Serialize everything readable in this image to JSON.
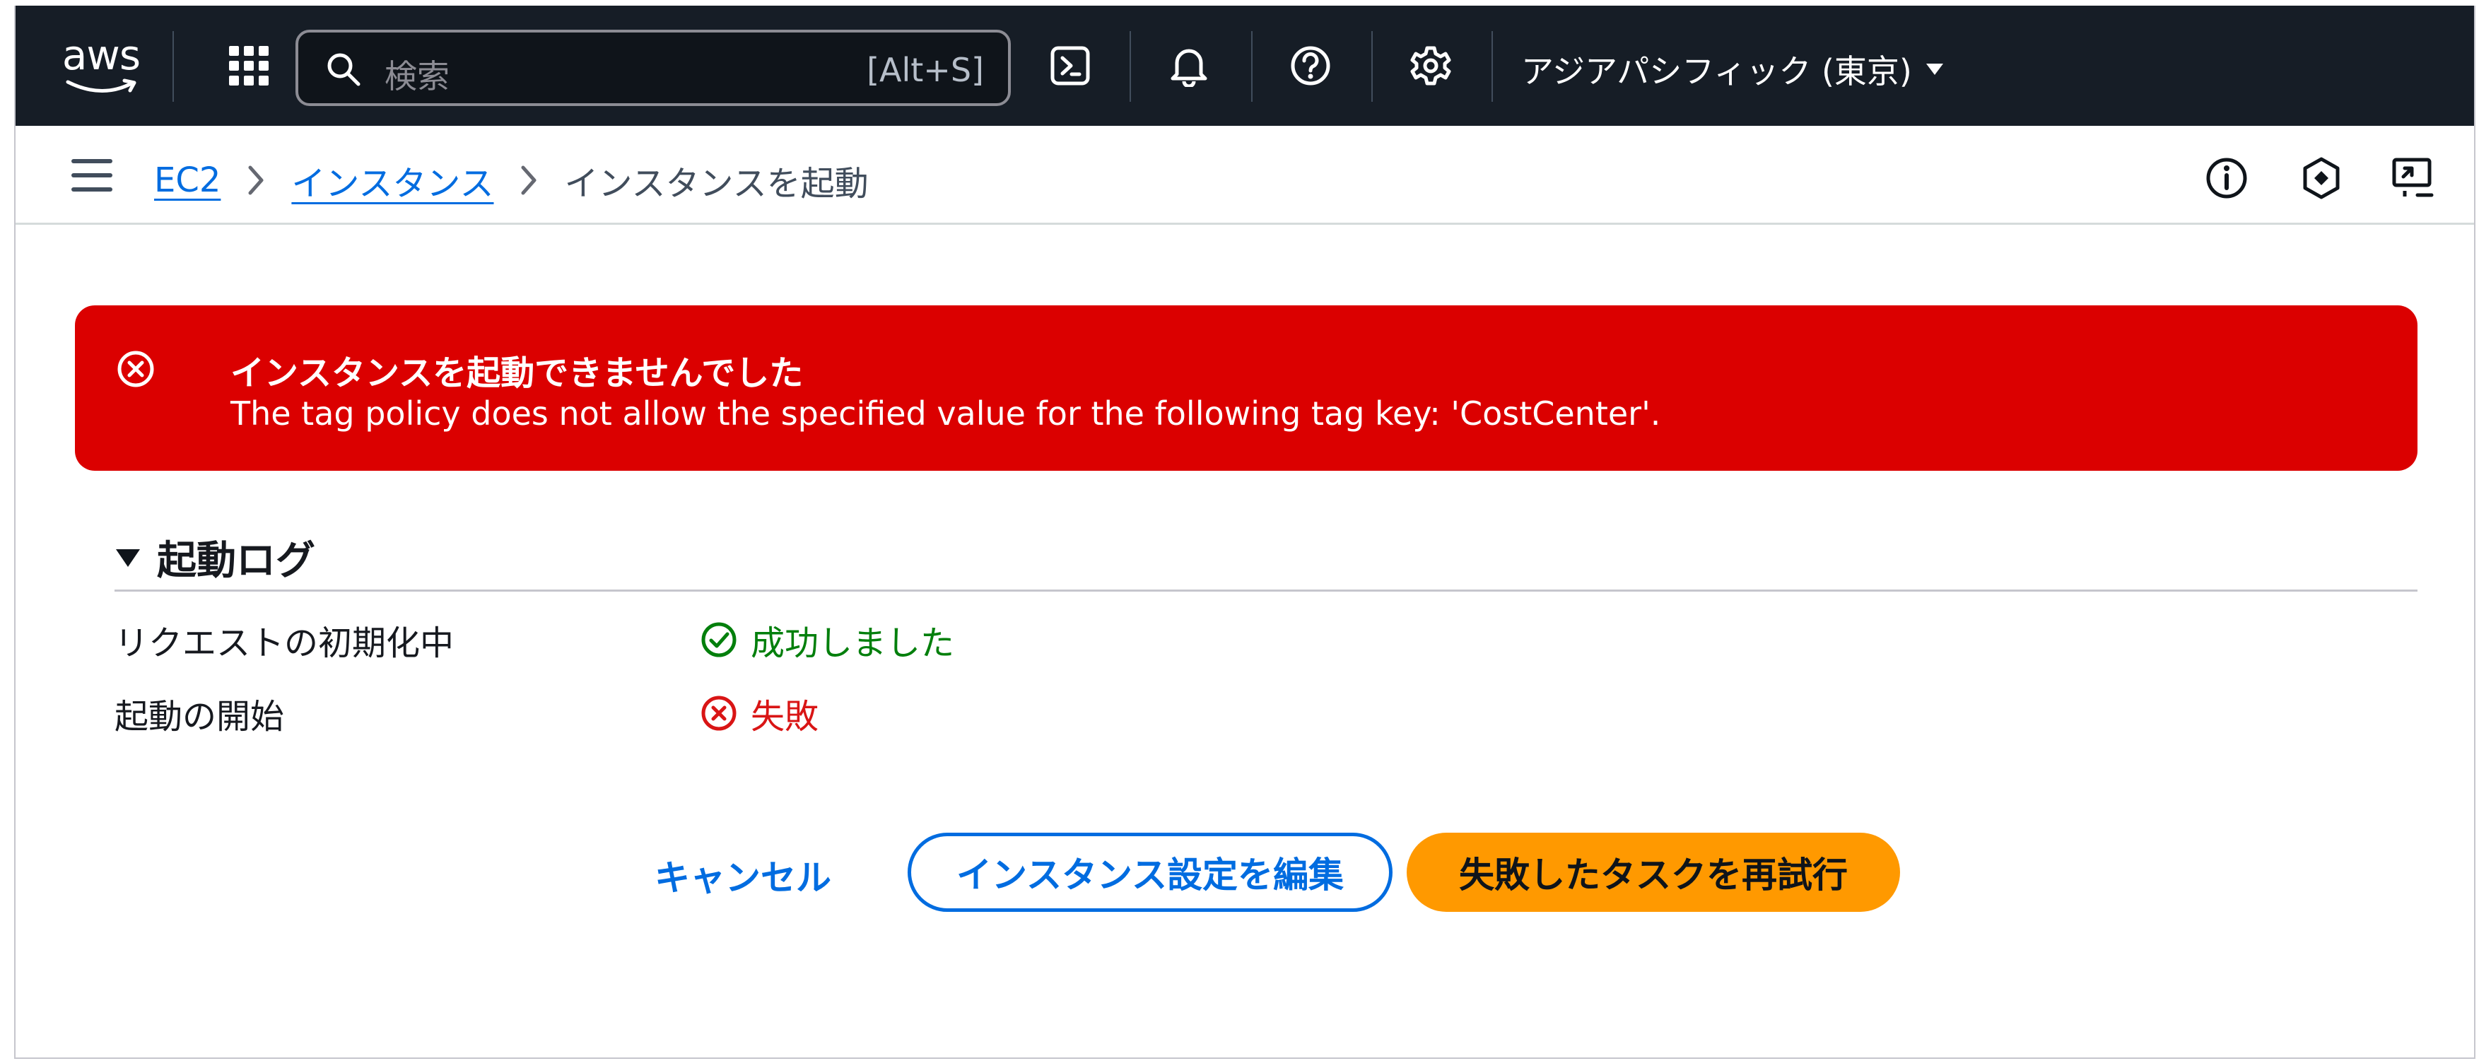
{
  "nav": {
    "logo_text": "aws",
    "search_placeholder": "検索",
    "search_shortcut": "[Alt+S]",
    "region_label": "アジアパシフィック (東京)",
    "icons": [
      "apps-grid-icon",
      "search-icon",
      "cloudshell-icon",
      "bell-icon",
      "help-icon",
      "gear-icon",
      "caret-down-icon"
    ]
  },
  "breadcrumb": {
    "items": [
      "EC2",
      "インスタンス"
    ],
    "current": "インスタンスを起動"
  },
  "alert": {
    "title": "インスタンスを起動できませんでした",
    "message": "The tag policy does not allow the specified value for the following tag key: 'CostCenter'.",
    "color": "#db0000"
  },
  "launch_log": {
    "heading": "起動ログ",
    "rows": [
      {
        "label": "リクエストの初期化中",
        "status": "成功しました",
        "state": "success"
      },
      {
        "label": "起動の開始",
        "status": "失敗",
        "state": "error"
      }
    ]
  },
  "actions": {
    "cancel": "キャンセル",
    "edit": "インスタンス設定を編集",
    "retry": "失敗したタスクを再試行"
  },
  "colors": {
    "nav_bg": "#161d26",
    "link": "#006ce0",
    "primary_button": "#ff9900",
    "success": "#037f0c",
    "error": "#d91515"
  }
}
